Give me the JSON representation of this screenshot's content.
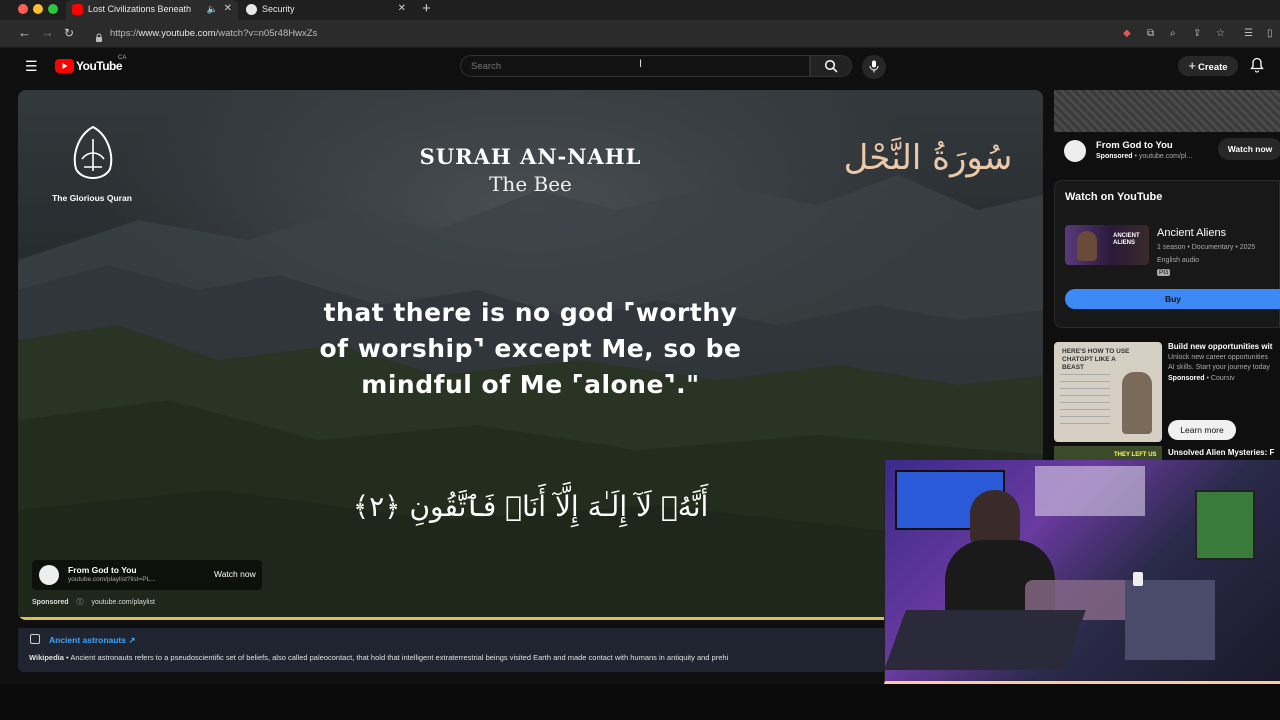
{
  "browser": {
    "tabs": [
      {
        "title": "Lost Civilizations Beneath",
        "active": true
      },
      {
        "title": "Security",
        "active": false
      }
    ],
    "url_prefix": "https://",
    "url_host": "www.youtube.com",
    "url_path": "/watch?v=n05r48HwxZs"
  },
  "youtube": {
    "logo_text": "YouTube",
    "region": "CA",
    "search_placeholder": "Search",
    "create_label": "Create"
  },
  "video": {
    "logo_caption": "The Glorious Quran",
    "surah_title": "SURAH AN-NAHL",
    "surah_subtitle": "The Bee",
    "arabic_title": "سُورَةُ النَّحْل",
    "translation_line1": "that there is no god ⌜worthy",
    "translation_line2": "of worship⌝ except Me, so be",
    "translation_line3": "mindful of Me ⌜alone⌝.\"",
    "arabic_verse": "أَنَّهُۥ لَآ إِلَـٰهَ إِلَّآ أَنَا۠ فَٱتَّقُونِ ﴿٢﴾",
    "overlay_ad": {
      "channel": "From God to You",
      "url": "youtube.com/playlist?list=PL...",
      "cta": "Watch now",
      "sponsored": "Sponsored",
      "sponsored_url": "youtube.com/playlist"
    }
  },
  "info_panel": {
    "topic": "Ancient astronauts",
    "source": "Wikipedia",
    "text": "Ancient astronauts refers to a pseudoscientific set of beliefs, also called paleocontact, that hold that intelligent extraterrestrial beings visited Earth and made contact with humans in antiquity and prehi"
  },
  "sidebar": {
    "ad1": {
      "channel": "From God to You",
      "sponsored": "Sponsored",
      "url": "youtube.com/pl...",
      "cta": "Watch now"
    },
    "watch_on_youtube": {
      "heading": "Watch on YouTube",
      "title": "Ancient Aliens",
      "meta": "1 season • Documentary • 2025",
      "audio": "English audio",
      "rating": "PG",
      "buy_label": "Buy",
      "thumb_text": "ANCIENT ALIENS"
    },
    "ad2": {
      "title": "Build new opportunities wit",
      "desc_line1": "Unlock new career opportunities",
      "desc_line2": "AI skills. Start your journey today",
      "sponsored": "Sponsored",
      "advertiser": "Coursiv",
      "cta": "Learn more",
      "thumb_title": "HERE'S HOW TO USE CHATGPT LIKE A BEAST"
    },
    "next_video_title": "Unsolved Alien Mysteries: F",
    "next_video_thumb_text": "THEY LEFT US"
  },
  "colors": {
    "youtube_red": "#ff0000",
    "link_blue": "#3ea6ff",
    "buy_blue": "#3d8af7",
    "progress_yellow": "#d8c24a"
  }
}
